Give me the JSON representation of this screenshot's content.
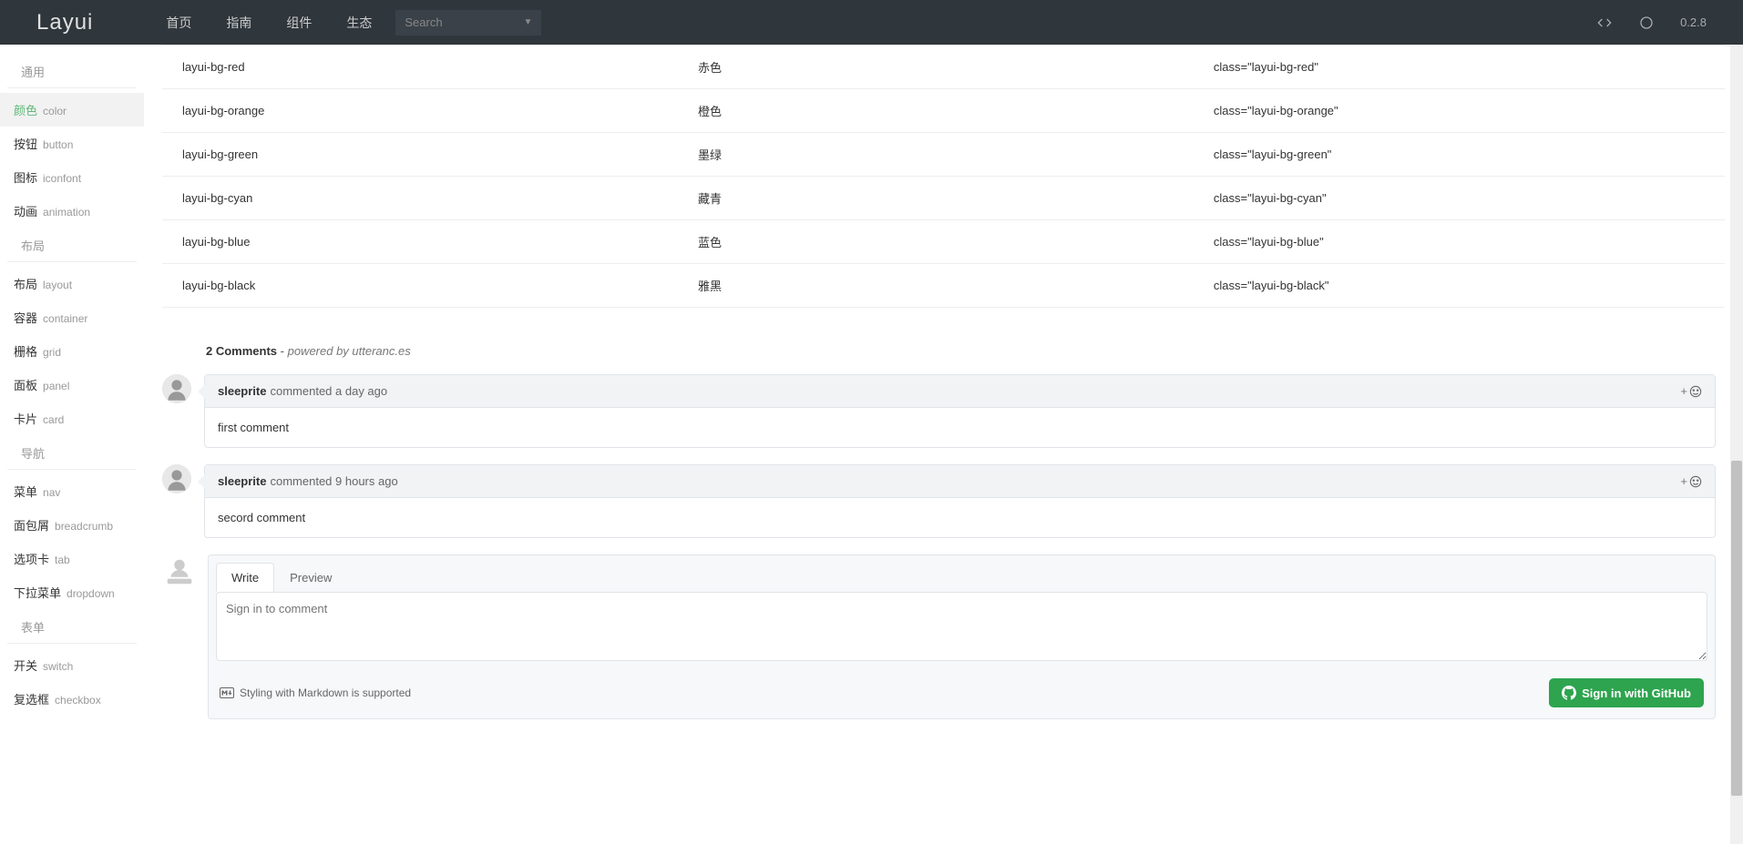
{
  "header": {
    "logo": "Layui",
    "nav": [
      {
        "label": "首页"
      },
      {
        "label": "指南"
      },
      {
        "label": "组件"
      },
      {
        "label": "生态"
      }
    ],
    "search_placeholder": "Search",
    "version": "0.2.8"
  },
  "sidebar": {
    "groups": [
      {
        "title": "通用",
        "items": [
          {
            "label": "颜色",
            "sub": "color",
            "active": true
          },
          {
            "label": "按钮",
            "sub": "button"
          },
          {
            "label": "图标",
            "sub": "iconfont"
          },
          {
            "label": "动画",
            "sub": "animation"
          }
        ]
      },
      {
        "title": "布局",
        "items": [
          {
            "label": "布局",
            "sub": "layout"
          },
          {
            "label": "容器",
            "sub": "container"
          },
          {
            "label": "栅格",
            "sub": "grid"
          },
          {
            "label": "面板",
            "sub": "panel"
          },
          {
            "label": "卡片",
            "sub": "card"
          }
        ]
      },
      {
        "title": "导航",
        "items": [
          {
            "label": "菜单",
            "sub": "nav"
          },
          {
            "label": "面包屑",
            "sub": "breadcrumb"
          },
          {
            "label": "选项卡",
            "sub": "tab"
          },
          {
            "label": "下拉菜单",
            "sub": "dropdown"
          }
        ]
      },
      {
        "title": "表单",
        "items": [
          {
            "label": "开关",
            "sub": "switch"
          },
          {
            "label": "复选框",
            "sub": "checkbox"
          }
        ]
      }
    ]
  },
  "table": {
    "rows": [
      {
        "cls": "layui-bg-red",
        "name": "赤色",
        "usage": "class=\"layui-bg-red\""
      },
      {
        "cls": "layui-bg-orange",
        "name": "橙色",
        "usage": "class=\"layui-bg-orange\""
      },
      {
        "cls": "layui-bg-green",
        "name": "墨绿",
        "usage": "class=\"layui-bg-green\""
      },
      {
        "cls": "layui-bg-cyan",
        "name": "藏青",
        "usage": "class=\"layui-bg-cyan\""
      },
      {
        "cls": "layui-bg-blue",
        "name": "蓝色",
        "usage": "class=\"layui-bg-blue\""
      },
      {
        "cls": "layui-bg-black",
        "name": "雅黑",
        "usage": "class=\"layui-bg-black\""
      }
    ]
  },
  "comments": {
    "count_label": "2 Comments",
    "dash": " - ",
    "powered": "powered by utteranc.es",
    "items": [
      {
        "author": "sleeprite",
        "meta": "commented a day ago",
        "body": "first comment"
      },
      {
        "author": "sleeprite",
        "meta": "commented 9 hours ago",
        "body": "secord comment"
      }
    ],
    "reaction": "+",
    "editor": {
      "tabs": {
        "write": "Write",
        "preview": "Preview"
      },
      "placeholder": "Sign in to comment",
      "markdown_note": "Styling with Markdown is supported",
      "signin": "Sign in with GitHub"
    }
  }
}
